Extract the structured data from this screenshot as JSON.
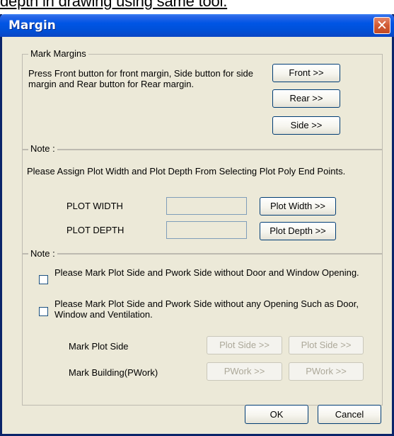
{
  "background_caption": "depth in drawing using same tool.",
  "window": {
    "title": "Margin",
    "close_glyph": "✕"
  },
  "mark_margins": {
    "label": "Mark Margins",
    "instruction": "Press Front button for front margin, Side button for side margin and Rear button for Rear margin.",
    "front_button": "Front >>",
    "rear_button": "Rear >>",
    "side_button": "Side >>"
  },
  "note1": {
    "label": "Note :",
    "text": "Please Assign Plot Width and Plot Depth From Selecting Plot Poly End Points.",
    "plot_width_label": "PLOT WIDTH",
    "plot_width_value": "",
    "plot_width_button": "Plot Width >>",
    "plot_depth_label": "PLOT DEPTH",
    "plot_depth_value": "",
    "plot_depth_button": "Plot Depth >>"
  },
  "note2": {
    "label": "Note :",
    "checkbox1_text": "Please Mark Plot Side and Pwork Side without Door and Window Opening.",
    "checkbox1_checked": false,
    "checkbox2_text": "Please Mark Plot Side and Pwork Side without any Opening Such as Door, Window and Ventilation.",
    "checkbox2_checked": false,
    "mark_plot_side_label": "Mark Plot Side",
    "plot_side_button_1": "Plot Side >>",
    "plot_side_button_2": "Plot Side >>",
    "mark_building_label": "Mark Building(PWork)",
    "pwork_button_1": "PWork >>",
    "pwork_button_2": "PWork >>"
  },
  "footer": {
    "ok_button": "OK",
    "cancel_button": "Cancel"
  },
  "colors": {
    "titlebar": "#0055e5",
    "dialog_bg": "#ece9d8",
    "close_button": "#d15a34",
    "disabled_text": "#aca899"
  }
}
